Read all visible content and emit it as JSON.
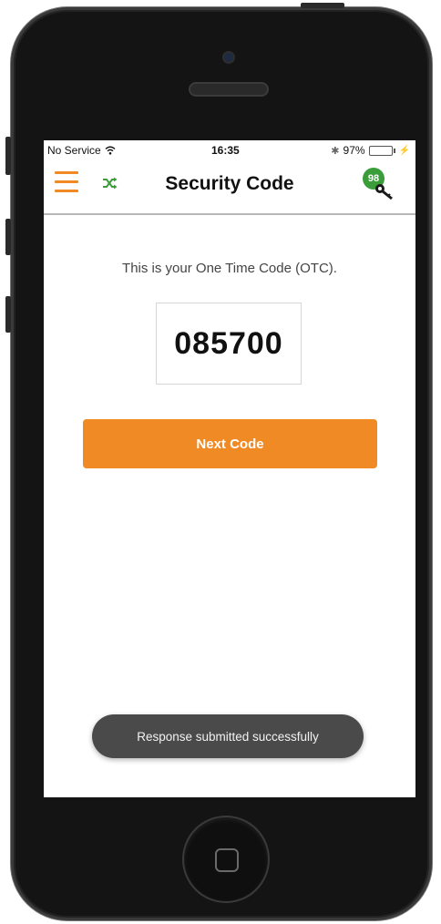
{
  "status_bar": {
    "carrier": "No Service",
    "time": "16:35",
    "battery_percent": "97%",
    "battery_level": 0.97,
    "icons": [
      "wifi-icon",
      "bluetooth-icon",
      "battery-icon",
      "charging-icon"
    ]
  },
  "nav": {
    "title": "Security Code",
    "badge_count": "98",
    "left_icons": [
      "menu-icon",
      "shuffle-icon"
    ],
    "right_icon": "key-icon"
  },
  "content": {
    "intro_text": "This is your One Time Code (OTC).",
    "code": "085700",
    "next_button_label": "Next Code"
  },
  "toast": {
    "message": "Response submitted successfully"
  },
  "colors": {
    "accent": "#f08a24",
    "badge": "#3a9d3a",
    "toast_bg": "#4a4a4a",
    "battery": "#4cd964"
  }
}
